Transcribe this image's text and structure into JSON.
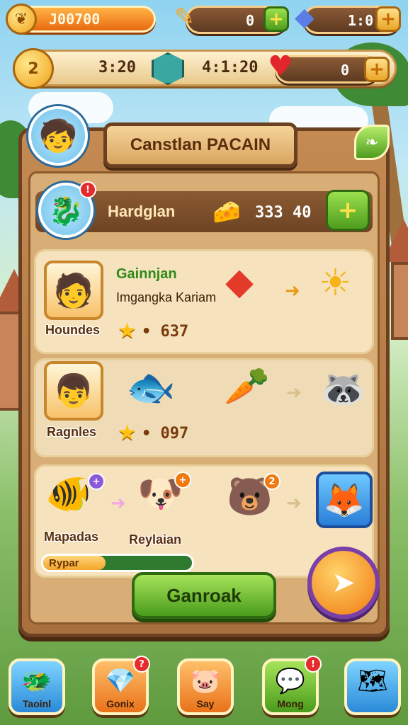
{
  "top_bar": {
    "coins": "J00700",
    "coin_icon": "leaf-coin-icon",
    "pencil_value": "0",
    "gem_value": "1:0"
  },
  "second_bar": {
    "left_badge": "2",
    "timer_1": "3:20",
    "timer_2": "4:1:20",
    "heart_value": "0"
  },
  "panel": {
    "title": "Canstlan PACAIN",
    "header_row": {
      "label": "Hardglan",
      "score": "333 40"
    },
    "cards": [
      {
        "name_green": "Gainnjan",
        "subtitle": "Imgangka Kariam",
        "portrait_label": "Houndes",
        "score": "• 637"
      },
      {
        "portrait_label": "Ragnles",
        "score": "• 097"
      }
    ],
    "bottom_card": {
      "left_label": "Mapadas",
      "mid_label": "Reylaian",
      "progress_label": "Rypar",
      "progress_value": 0.42,
      "badge_1": "+",
      "badge_2": "+",
      "badge_3": "2"
    },
    "main_button": "Ganroak"
  },
  "nav": [
    {
      "label": "Taoinl",
      "icon": "creature-icon"
    },
    {
      "label": "Gonix",
      "icon": "gem-icon",
      "badge": "?"
    },
    {
      "label": "Say",
      "icon": "pig-icon"
    },
    {
      "label": "Mong",
      "icon": "chat-icon",
      "badge": "!"
    },
    {
      "label": "",
      "icon": "map-icon"
    }
  ],
  "colors": {
    "wood": "#a8703e",
    "accent_green": "#4a9c1c",
    "accent_orange": "#f07a10",
    "badge_red": "#e52b2b"
  }
}
